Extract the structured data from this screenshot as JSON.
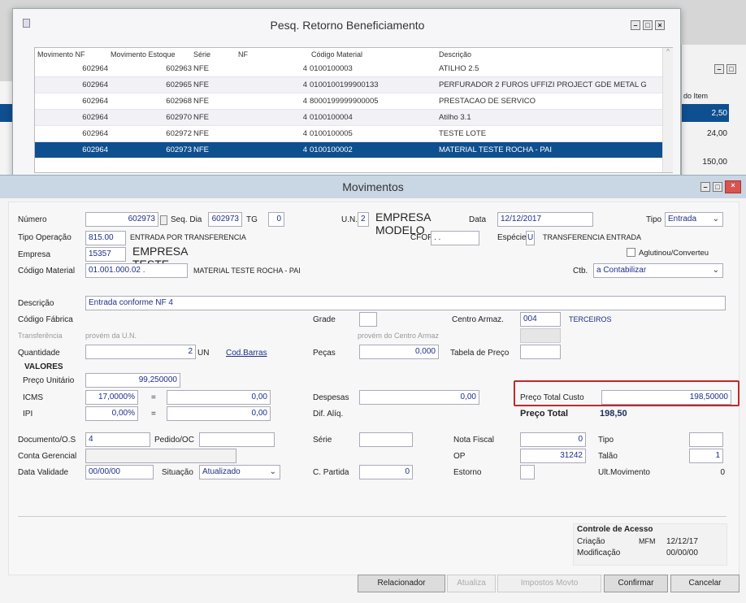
{
  "search_window": {
    "title": "Pesq. Retorno Beneficiamento",
    "columns": [
      "Movimento NF",
      "Movimento Estoque",
      "Série",
      "NF",
      "Código Material",
      "Descrição"
    ],
    "rows": [
      {
        "mov_nf": "602964",
        "mov_estoque": "602963",
        "serie": "NFE",
        "nf": "4",
        "codigo": "0100100003",
        "descricao": "ATILHO 2.5"
      },
      {
        "mov_nf": "602964",
        "mov_estoque": "602965",
        "serie": "NFE",
        "nf": "4",
        "codigo": "0100100199900133",
        "descricao": "PERFURADOR 2 FUROS UFFIZI PROJECT GDE METAL G"
      },
      {
        "mov_nf": "602964",
        "mov_estoque": "602968",
        "serie": "NFE",
        "nf": "4",
        "codigo": "8000199999900005",
        "descricao": "PRESTACAO DE SERVICO"
      },
      {
        "mov_nf": "602964",
        "mov_estoque": "602970",
        "serie": "NFE",
        "nf": "4",
        "codigo": "0100100004",
        "descricao": "Atilho 3.1"
      },
      {
        "mov_nf": "602964",
        "mov_estoque": "602972",
        "serie": "NFE",
        "nf": "4",
        "codigo": "0100100005",
        "descricao": "TESTE LOTE"
      },
      {
        "mov_nf": "602964",
        "mov_estoque": "602973",
        "serie": "NFE",
        "nf": "4",
        "codigo": "0100100002",
        "descricao": "MATERIAL TESTE ROCHA - PAI"
      }
    ]
  },
  "background_window": {
    "column": "do Item",
    "values": [
      "2,50",
      "24,00",
      "150,00"
    ]
  },
  "main": {
    "title": "Movimentos",
    "numero_label": "Número",
    "numero": "602973",
    "seq_dia_label": "Seq. Dia",
    "seq_dia": "602973",
    "tg_label": "TG",
    "tg": "0",
    "un_label": "U.N.",
    "un": "2",
    "un_name": "EMPRESA MODELO",
    "data_label": "Data",
    "data": "12/12/2017",
    "tipo_label": "Tipo",
    "tipo": "Entrada",
    "tipo_operacao_label": "Tipo Operação",
    "tipo_operacao": "815.00",
    "tipo_operacao_desc": "ENTRADA POR TRANSFERENCIA",
    "cfop_label": "CFOP",
    "cfop": ". .",
    "especie_label": "Espécie",
    "especie": "U",
    "especie_desc": "TRANSFERENCIA ENTRADA",
    "empresa_label": "Empresa",
    "empresa": "15357",
    "empresa_name": "EMPRESA TESTE",
    "aglutinou_label": "Aglutinou/Converteu",
    "codigo_material_label": "Código Material",
    "codigo_material": "01.001.000.02 .",
    "material_desc": "MATERIAL TESTE ROCHA - PAI",
    "ctb_label": "Ctb.",
    "ctb": "a Contabilizar",
    "descricao_label": "Descrição",
    "descricao": "Entrada conforme NF 4",
    "codigo_fabrica_label": "Código Fábrica",
    "grade_label": "Grade",
    "centro_armaz_label": "Centro Armaz.",
    "centro_armaz": "004",
    "centro_armaz_desc": "TERCEIROS",
    "transferencia_label": "Transferência",
    "provem_un": "provém da U.N.",
    "provem_centro": "provém do Centro Armaz",
    "quantidade_label": "Quantidade",
    "quantidade": "2",
    "unidade": "UN",
    "cod_barras": "Cod.Barras",
    "pecas_label": "Peças",
    "pecas": "0,000",
    "tabela_preco_label": "Tabela de Preço",
    "valores_label": "VALORES",
    "preco_unitario_label": "Preço Unitário",
    "preco_unitario": "99,250000",
    "icms_label": "ICMS",
    "icms_pct": "17,0000%",
    "icms_value": "0,00",
    "equals": "=",
    "ipi_label": "IPI",
    "ipi_pct": "0,00%",
    "ipi_value": "0,00",
    "despesas_label": "Despesas",
    "despesas": "0,00",
    "dif_aliq_label": "Dif. Alíq.",
    "preco_total_custo_label": "Preço Total Custo",
    "preco_total_custo": "198,50000",
    "preco_total_label": "Preço Total",
    "preco_total": "198,50",
    "documento_label": "Documento/O.S",
    "documento": "4",
    "pedido_label": "Pedido/OC",
    "serie_label": "Série",
    "nota_fiscal_label": "Nota Fiscal",
    "nota_fiscal": "0",
    "tipo2_label": "Tipo",
    "conta_gerencial_label": "Conta Gerencial",
    "op_label": "OP",
    "op": "31242",
    "talao_label": "Talão",
    "talao": "1",
    "data_validade_label": "Data Validade",
    "data_validade": "00/00/00",
    "situacao_label": "Situação",
    "situacao": "Atualizado",
    "c_partida_label": "C. Partida",
    "c_partida": "0",
    "estorno_label": "Estorno",
    "ult_movimento_label": "Ult.Movimento",
    "ult_movimento": "0",
    "controle": {
      "title": "Controle de Acesso",
      "criacao_label": "Criação",
      "criacao_user": "MFM",
      "criacao_date": "12/12/17",
      "modificacao_label": "Modificação",
      "modificacao_date": "00/00/00"
    },
    "buttons": {
      "relacionador": "Relacionador",
      "atualiza": "Atualiza",
      "impostos": "Impostos Movto",
      "confirmar": "Confirmar",
      "cancelar": "Cancelar"
    }
  },
  "colors": {
    "selection": "#0e4f8f",
    "highlight_box": "#c0282d",
    "close_button": "#d9534f"
  }
}
